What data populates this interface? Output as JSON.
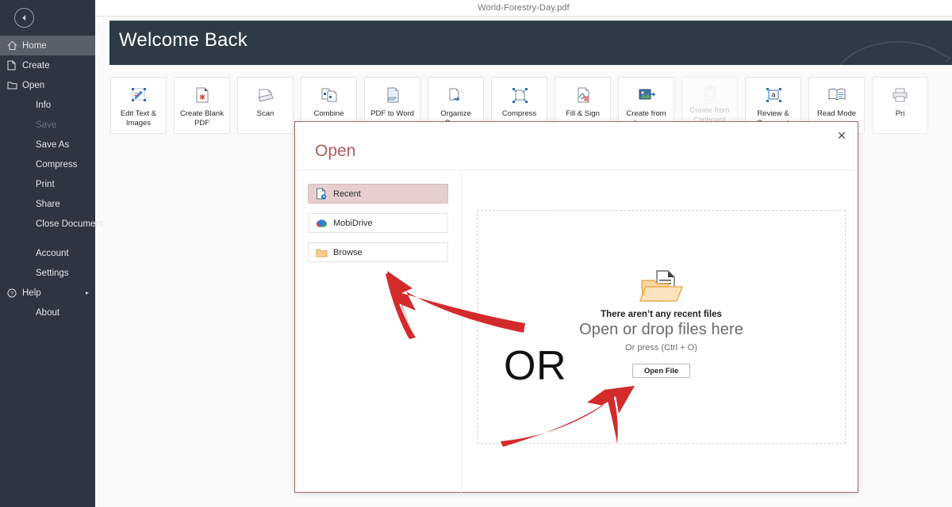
{
  "window": {
    "title": "World-Forestry-Day.pdf"
  },
  "sidebar": {
    "back_icon": "arrow-left-circle-icon",
    "items": [
      {
        "label": "Home",
        "icon": "home-icon",
        "state": "active",
        "indent": false
      },
      {
        "label": "Create",
        "icon": "page-icon",
        "state": "normal",
        "indent": false
      },
      {
        "label": "Open",
        "icon": "folder-icon",
        "state": "normal",
        "indent": false
      },
      {
        "label": "Info",
        "icon": "",
        "state": "normal",
        "indent": true
      },
      {
        "label": "Save",
        "icon": "",
        "state": "disabled",
        "indent": true
      },
      {
        "label": "Save As",
        "icon": "",
        "state": "normal",
        "indent": true
      },
      {
        "label": "Compress",
        "icon": "",
        "state": "normal",
        "indent": true
      },
      {
        "label": "Print",
        "icon": "",
        "state": "normal",
        "indent": true
      },
      {
        "label": "Share",
        "icon": "",
        "state": "normal",
        "indent": true
      },
      {
        "label": "Close Document",
        "icon": "",
        "state": "normal",
        "indent": true
      },
      {
        "label": "Account",
        "icon": "",
        "state": "normal",
        "indent": true,
        "gap_before": true
      },
      {
        "label": "Settings",
        "icon": "",
        "state": "normal",
        "indent": true
      },
      {
        "label": "Help",
        "icon": "help-circle-icon",
        "state": "normal",
        "indent": false,
        "chevron": "▸"
      },
      {
        "label": "About",
        "icon": "",
        "state": "normal",
        "indent": true
      }
    ]
  },
  "banner": {
    "title": "Welcome Back",
    "background": "#2e3b45"
  },
  "tools": [
    {
      "label": "Edit Text & Images",
      "icon": "edit-text-images-icon",
      "disabled": false
    },
    {
      "label": "Create Blank PDF",
      "icon": "create-blank-pdf-icon",
      "disabled": false
    },
    {
      "label": "Scan",
      "icon": "scan-icon",
      "disabled": false
    },
    {
      "label": "Combine",
      "icon": "combine-icon",
      "disabled": false
    },
    {
      "label": "PDF to Word",
      "icon": "pdf-to-word-icon",
      "disabled": false
    },
    {
      "label": "Organize Pages",
      "icon": "organize-pages-icon",
      "disabled": false
    },
    {
      "label": "Compress",
      "icon": "compress-icon",
      "disabled": false
    },
    {
      "label": "Fill & Sign",
      "icon": "fill-sign-icon",
      "disabled": false
    },
    {
      "label": "Create from Images",
      "icon": "create-from-images-icon",
      "disabled": false
    },
    {
      "label": "Create from Clipboard Image",
      "icon": "create-from-clipboard-icon",
      "disabled": true
    },
    {
      "label": "Review & Comment",
      "icon": "review-comment-icon",
      "disabled": false
    },
    {
      "label": "Read Mode",
      "icon": "read-mode-icon",
      "disabled": false
    },
    {
      "label": "Pri",
      "icon": "print-icon",
      "disabled": false
    }
  ],
  "dialog": {
    "title": "Open",
    "close_icon": "close-icon",
    "accent": "#b05a5a",
    "places": [
      {
        "label": "Recent",
        "icon": "recent-file-icon",
        "selected": true
      },
      {
        "label": "MobiDrive",
        "icon": "mobidrive-icon",
        "selected": false
      },
      {
        "label": "Browse",
        "icon": "folder-icon",
        "selected": false
      }
    ],
    "dropzone": {
      "folder_icon": "open-folder-document-icon",
      "no_files_text": "There aren’t any recent files",
      "headline": "Open or drop files here",
      "hint": "Or press (Ctrl + O)",
      "button_label": "Open File"
    },
    "or_label": "OR"
  },
  "annotations": {
    "arrow_color": "#d32b2b",
    "arrows": [
      {
        "name": "arrow-to-places-list",
        "direction": "up-left"
      },
      {
        "name": "arrow-to-open-file-button",
        "direction": "up-right"
      }
    ]
  }
}
